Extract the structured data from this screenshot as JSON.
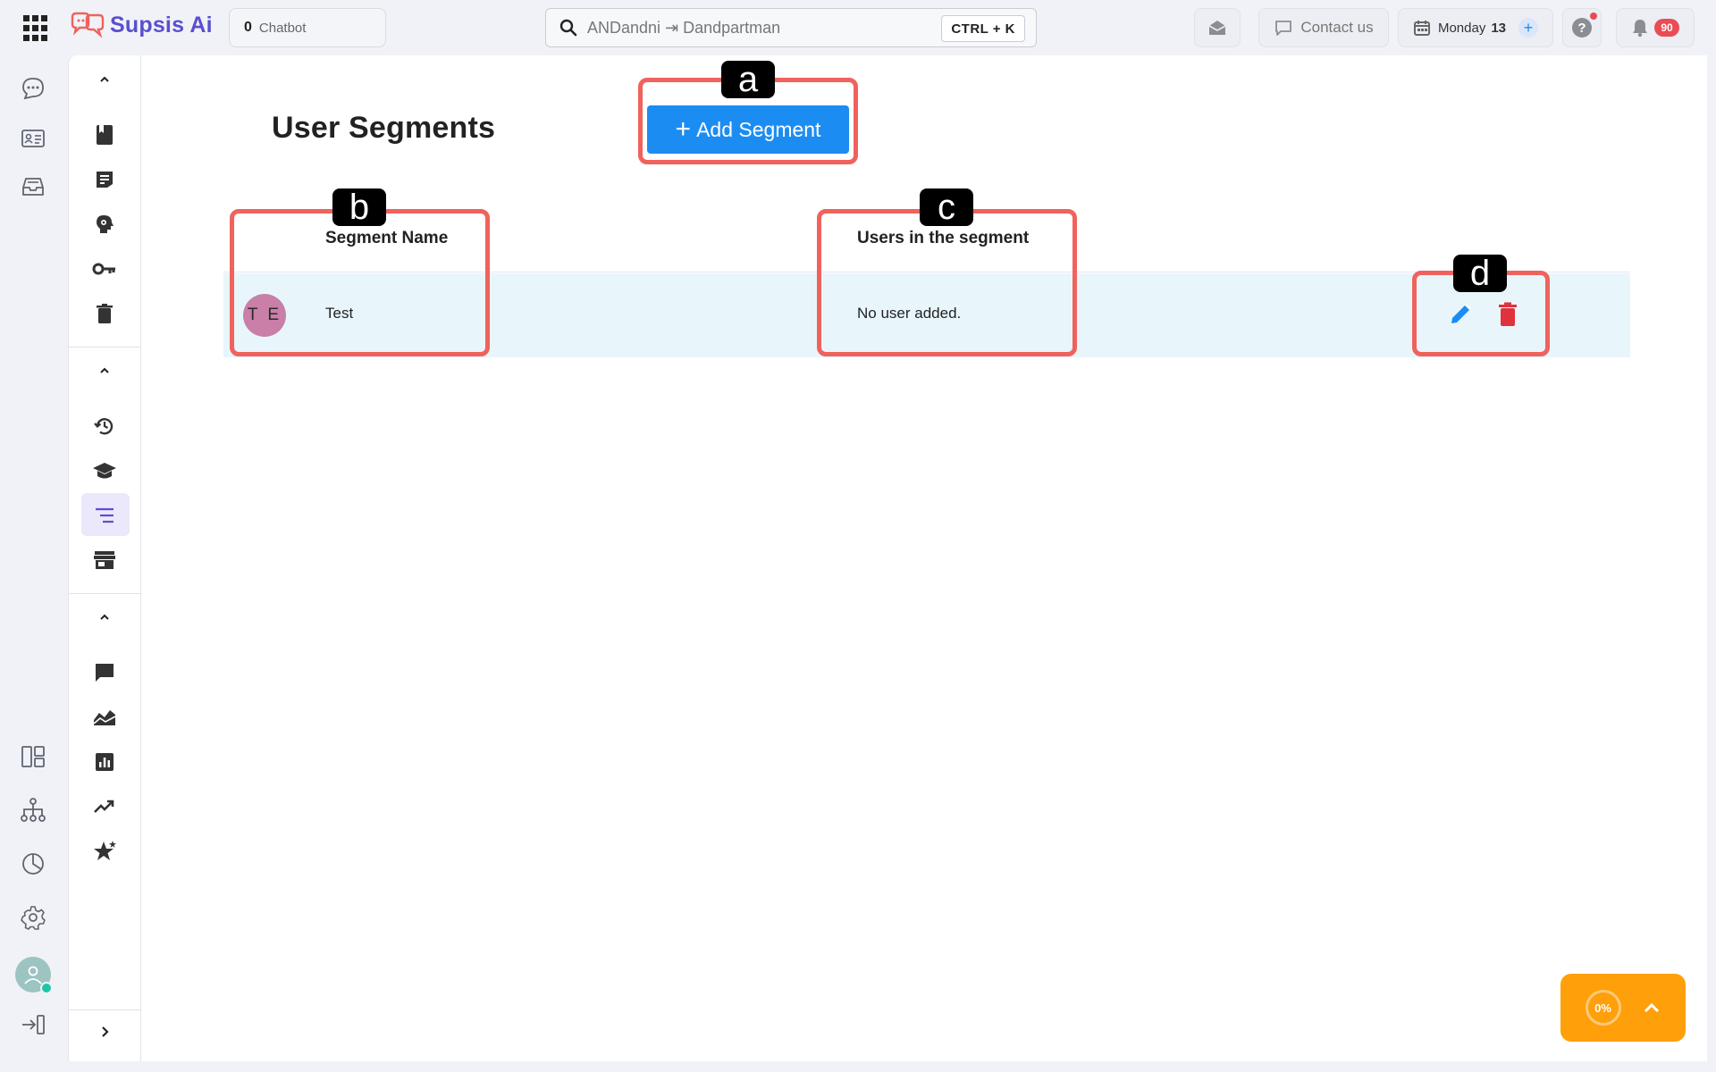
{
  "header": {
    "brand": "Supsis Ai",
    "chatbot_count": "0",
    "chatbot_label": "Chatbot",
    "search_value": "ANDandni ⇥ Dandpartman",
    "search_shortcut": "CTRL + K",
    "contact_label": "Contact us",
    "date_day": "Monday",
    "date_num": "13",
    "notification_count": "90"
  },
  "page": {
    "title": "User Segments",
    "add_button": "Add Segment"
  },
  "table": {
    "columns": [
      "Segment Name",
      "Users in the segment"
    ],
    "rows": [
      {
        "initials": "T E",
        "name": "Test",
        "users": "No user added."
      }
    ]
  },
  "annotations": [
    "a",
    "b",
    "c",
    "d"
  ],
  "progress": {
    "label": "0%"
  },
  "colors": {
    "primary": "#1b8df2",
    "brand": "#5a4fcf",
    "annotation": "#f0625c",
    "delete": "#e0323c",
    "edit": "#1b8df2",
    "fab": "#ff9f0a",
    "row_bg": "#e8f6fc",
    "avatar_bg": "#c97fa7"
  }
}
